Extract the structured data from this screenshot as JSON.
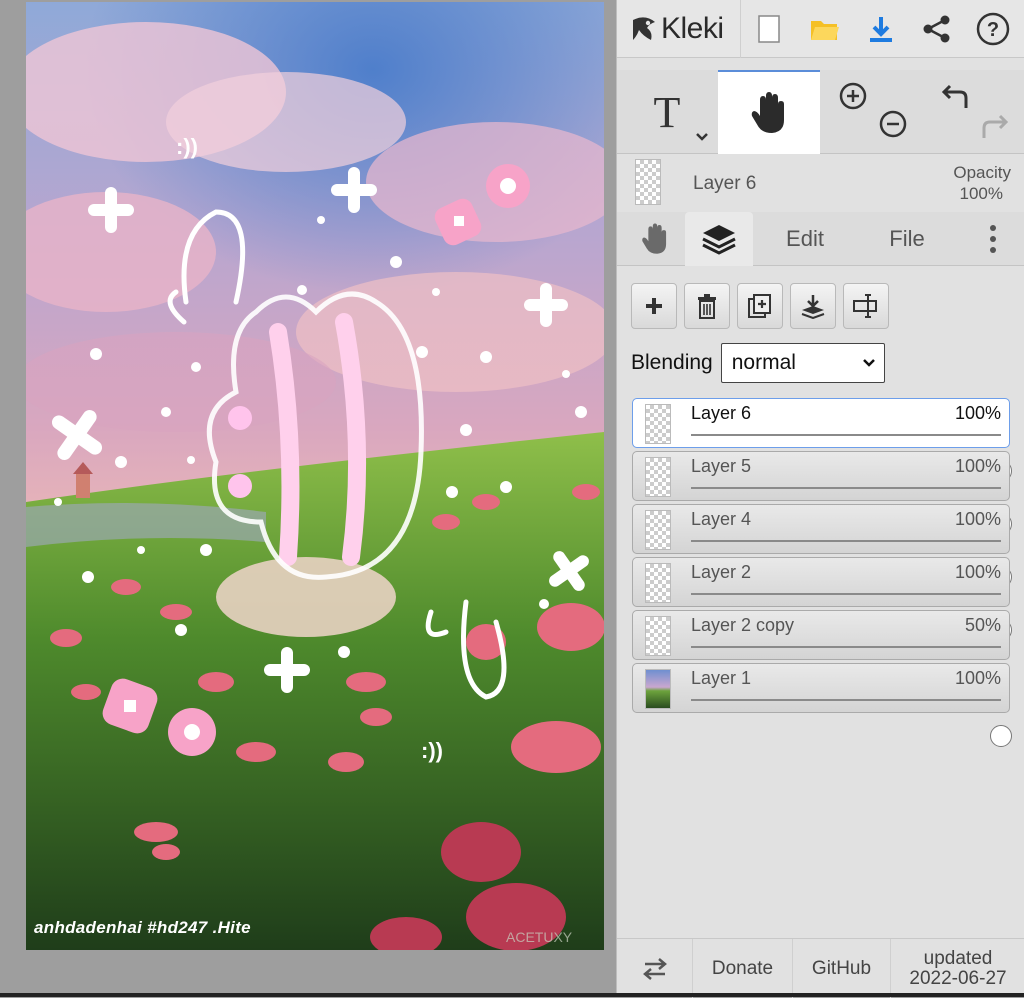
{
  "canvas": {
    "signature": "anhdadenhai #hd247 .Hite",
    "ascii_smile_1": ":))",
    "ascii_smile_2": ":))",
    "watermark": "ACETUXY"
  },
  "topbar": {
    "app_name": "Kleki",
    "icons": [
      "new-image-icon",
      "open-folder-icon",
      "download-icon",
      "share-icon",
      "help-icon"
    ]
  },
  "tools": {
    "text_tool_glyph": "T",
    "active": "hand-tool",
    "icons": [
      "text-tool-icon",
      "hand-tool-icon",
      "zoom-in-icon",
      "zoom-out-icon",
      "undo-icon",
      "redo-icon"
    ]
  },
  "layer_header": {
    "name": "Layer 6",
    "opacity_label": "Opacity",
    "opacity_value": "100%"
  },
  "tabs": [
    {
      "label": "Edit"
    },
    {
      "label": "File"
    }
  ],
  "blending": {
    "label": "Blending",
    "value": "normal"
  },
  "layers": [
    {
      "name": "Layer 6",
      "opacity_text": "100%",
      "opacity": 1.0,
      "selected": true
    },
    {
      "name": "Layer 5",
      "opacity_text": "100%",
      "opacity": 1.0
    },
    {
      "name": "Layer 4",
      "opacity_text": "100%",
      "opacity": 1.0
    },
    {
      "name": "Layer 2",
      "opacity_text": "100%",
      "opacity": 1.0
    },
    {
      "name": "Layer 2 copy",
      "opacity_text": "50%",
      "opacity": 0.5
    },
    {
      "name": "Layer 1",
      "opacity_text": "100%",
      "opacity": 1.0
    }
  ],
  "footer": {
    "donate": "Donate",
    "github": "GitHub",
    "updated_label": "updated",
    "updated_date": "2022-06-27"
  },
  "colors": {
    "accent": "#5b8dd9",
    "download": "#1e7be0",
    "folder": "#f5c026",
    "panel_bg": "#e1e1e1",
    "pink_doodle": "#ffc4ec"
  }
}
